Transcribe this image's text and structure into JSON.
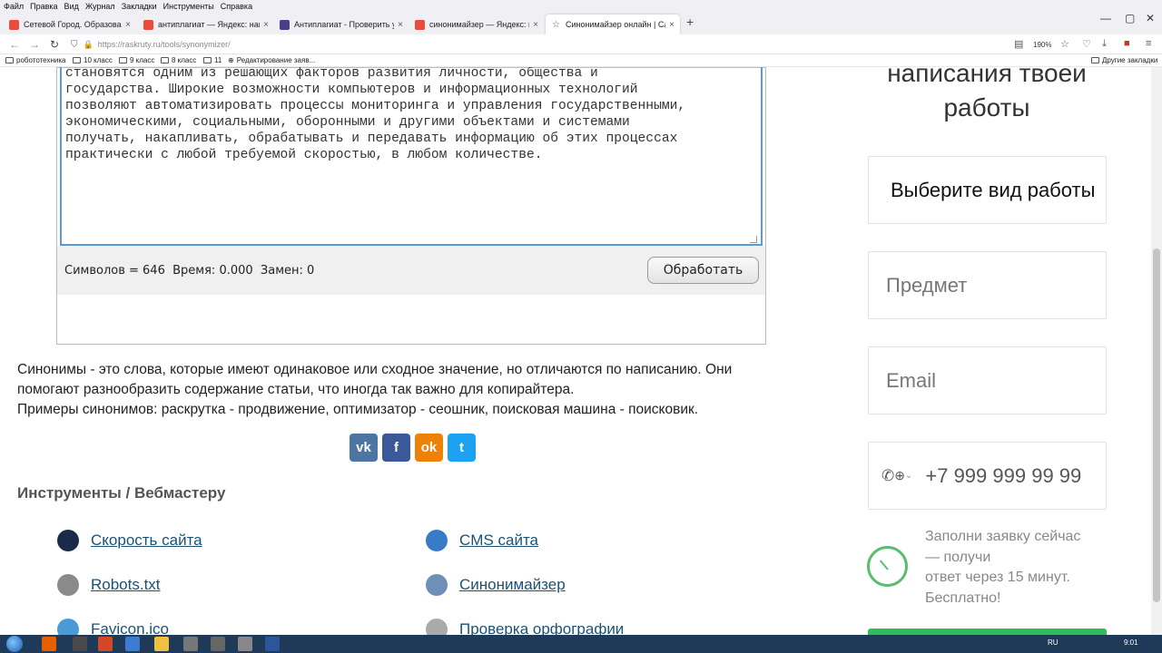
{
  "menu": [
    "Файл",
    "Правка",
    "Вид",
    "Журнал",
    "Закладки",
    "Инструменты",
    "Справка"
  ],
  "tabs": [
    {
      "title": "Сетевой Город. Образование",
      "color": "#e74c3c"
    },
    {
      "title": "антиплагиат — Яндекс: нашё",
      "color": "#e74c3c"
    },
    {
      "title": "Антиплагиат - Проверить уни",
      "color": "#4a3e8a"
    },
    {
      "title": "синонимайзер — Яндекс: на",
      "color": "#e74c3c"
    },
    {
      "title": "Синонимайзер онлайн | Сло",
      "color": "#777777"
    }
  ],
  "url": "https://raskruty.ru/tools/synonymizer/",
  "zoom": "190%",
  "bookmarks": [
    "робототехника",
    "10 класс",
    "9 класс",
    "8 класс",
    "11",
    "Редактирование заяв...",
    "Другие закладки"
  ],
  "editor": {
    "text": "становятся одним из решающих факторов развития личности, общества и\nгосударства. Широкие возможности компьютеров и информационных технологий\nпозволяют автоматизировать процессы мониторинга и управления государственными,\nэкономическими, социальными, оборонными и другими объектами и системами\nполучать, накапливать, обрабатывать и передавать информацию об этих процессах\nпрактически с любой требуемой скоростью, в любом количестве."
  },
  "stats": {
    "symbols_label": "Символов = ",
    "symbols_value": "646",
    "time_label": "Время: ",
    "time_value": "0.000",
    "replace_label": "Замен: ",
    "replace_value": "0"
  },
  "process_label": "Обработать",
  "description": [
    "Синонимы - это слова, которые имеют одинаковое или сходное значение, но отличаются по написанию. Они",
    "помогают разнообразить содержание статьи, что иногда так важно для копирайтера.",
    "Примеры синонимов: раскрутка - продвижение, оптимизатор - сеошник, поисковая машина - поисковик."
  ],
  "social": [
    {
      "glyph": "vk",
      "color": "#4c75a3"
    },
    {
      "glyph": "f",
      "color": "#3b5998"
    },
    {
      "glyph": "ok",
      "color": "#ee8208"
    },
    {
      "glyph": "t",
      "color": "#1da1f2"
    }
  ],
  "tools_title": "Инструменты / Вебмастеру",
  "tools": [
    {
      "label": "Скорость сайта",
      "icon": "speed-icon",
      "color": "#1a2b4a"
    },
    {
      "label": "CMS сайта",
      "icon": "cms-icon",
      "color": "#3a7bc8"
    },
    {
      "label": "Robots.txt",
      "icon": "android-icon",
      "color": "#8a8a8a"
    },
    {
      "label": "Синонимайзер",
      "icon": "synonym-icon",
      "color": "#6d8fb8"
    },
    {
      "label": "Favicon.ico",
      "icon": "star-icon",
      "color": "#4a9ad8"
    },
    {
      "label": "Проверка орфографии",
      "icon": "spelling-icon",
      "color": "#aaaaaa"
    }
  ],
  "sidebar": {
    "title_line1": "написания твоей",
    "title_line2": "работы",
    "select_label": "Выберите вид работы",
    "subject_placeholder": "Предмет",
    "email_placeholder": "Email",
    "phone_placeholder": "+7 999 999 99 99",
    "promo": [
      "Заполни заявку сейчас",
      "— получи",
      "ответ через 15 минут.",
      "Бесплатно!"
    ],
    "accent_color": "#2ebd59"
  },
  "taskbar": {
    "lang": "RU",
    "time": "9:01"
  }
}
